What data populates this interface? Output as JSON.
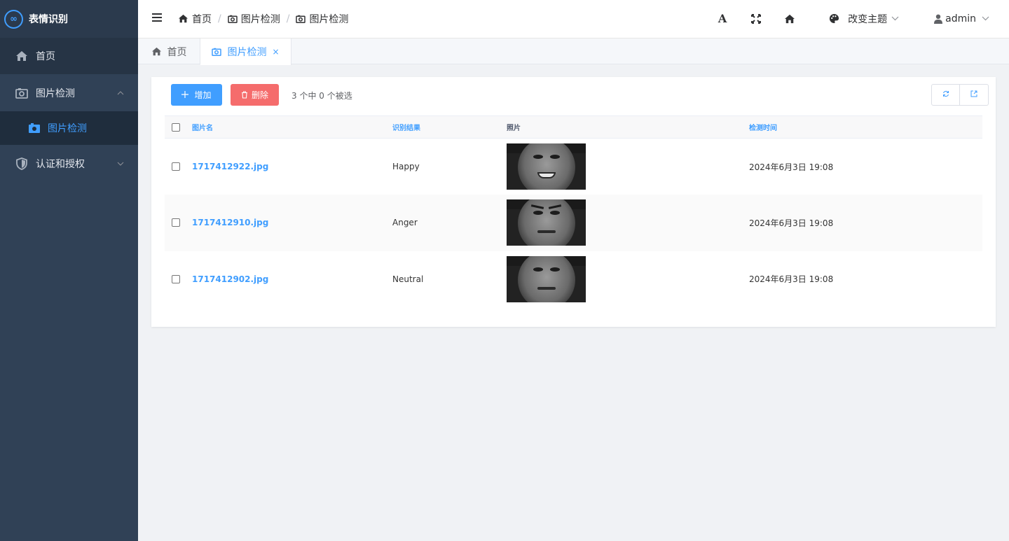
{
  "app": {
    "title": "表情识别",
    "logo_glyph": "∞"
  },
  "sidebar": {
    "items": [
      {
        "label": "首页",
        "icon": "home-icon"
      },
      {
        "label": "图片检测",
        "icon": "camera-icon",
        "expanded": true,
        "children": [
          {
            "label": "图片检测",
            "icon": "camera-icon",
            "active": true
          }
        ]
      },
      {
        "label": "认证和授权",
        "icon": "shield-icon",
        "expanded": false
      }
    ]
  },
  "navbar": {
    "breadcrumb": [
      {
        "label": "首页",
        "icon": "home-icon"
      },
      {
        "label": "图片检测",
        "icon": "camera-icon"
      },
      {
        "label": "图片检测",
        "icon": "camera-icon"
      }
    ],
    "breadcrumb_separator": "/",
    "font_glyph": "A",
    "theme_label": "改变主题",
    "user_label": "admin"
  },
  "tabs": [
    {
      "label": "首页",
      "icon": "home-icon",
      "active": false
    },
    {
      "label": "图片检测",
      "icon": "camera-icon",
      "active": true,
      "close": "×"
    }
  ],
  "toolbar": {
    "add_label": "增加",
    "delete_label": "删除",
    "selection_text": "3 个中 0 个被选"
  },
  "table": {
    "columns": [
      "图片名",
      "识别结果",
      "照片",
      "检测时间"
    ],
    "rows": [
      {
        "name": "1717412922.jpg",
        "result": "Happy",
        "time": "2024年6月3日 19:08"
      },
      {
        "name": "1717412910.jpg",
        "result": "Anger",
        "time": "2024年6月3日 19:08"
      },
      {
        "name": "1717412902.jpg",
        "result": "Neutral",
        "time": "2024年6月3日 19:08"
      }
    ]
  },
  "colors": {
    "primary": "#409eff",
    "danger": "#f56c6c",
    "sidebar_bg": "#304156"
  }
}
